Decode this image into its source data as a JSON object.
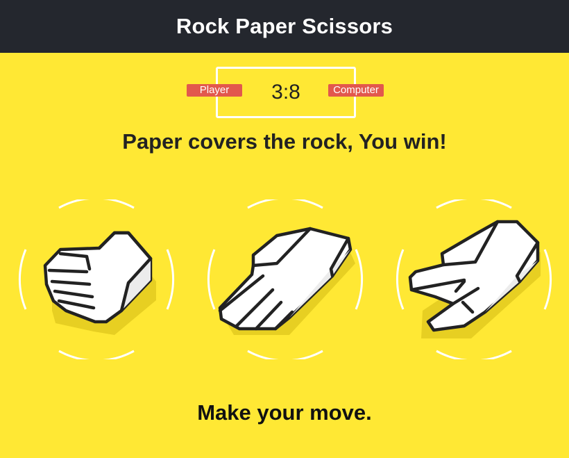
{
  "header": {
    "title": "Rock Paper Scissors"
  },
  "scoreboard": {
    "player_label": "Player",
    "computer_label": "Computer",
    "score": "3:8"
  },
  "result_message": "Paper covers the rock, You win!",
  "choices": [
    {
      "id": "rock",
      "icon": "rock-hand-icon"
    },
    {
      "id": "paper",
      "icon": "paper-hand-icon"
    },
    {
      "id": "scissors",
      "icon": "scissors-hand-icon"
    }
  ],
  "prompt": "Make your move.",
  "colors": {
    "background": "#ffe834",
    "header": "#24272e",
    "badge": "#e2584d",
    "ring": "#ffffff",
    "hand_fill": "#ffffff",
    "hand_shade": "#e9e9e9",
    "outline": "#222222"
  }
}
